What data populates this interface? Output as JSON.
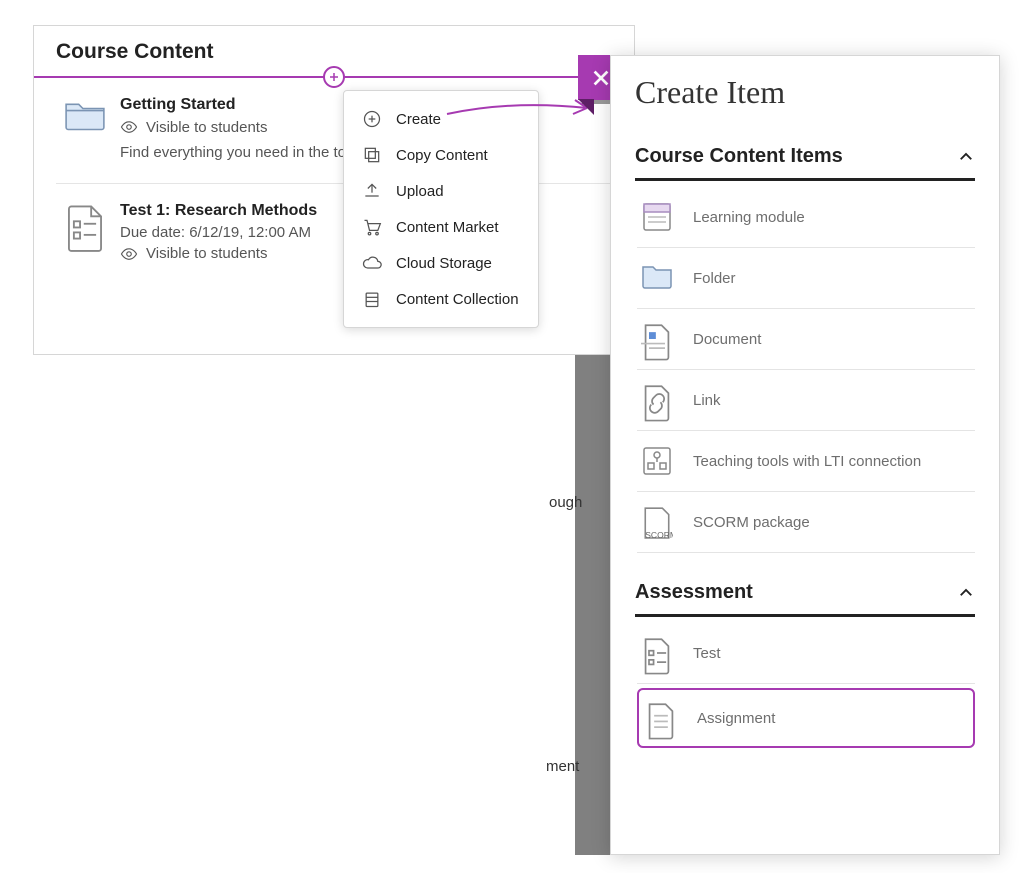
{
  "course": {
    "title": "Course Content",
    "items": [
      {
        "icon": "folder",
        "title": "Getting Started",
        "visibility": "Visible to students",
        "description": "Find everything you need in the                                       to the throughout the term."
      },
      {
        "icon": "test",
        "title": "Test 1: Research Methods",
        "subtitle": "Due date: 6/12/19, 12:00 AM",
        "visibility": "Visible to students"
      }
    ]
  },
  "context_menu": [
    {
      "icon": "plus-circle",
      "label": "Create"
    },
    {
      "icon": "copy",
      "label": "Copy Content"
    },
    {
      "icon": "upload",
      "label": "Upload"
    },
    {
      "icon": "cart",
      "label": "Content Market"
    },
    {
      "icon": "cloud",
      "label": "Cloud Storage"
    },
    {
      "icon": "collection",
      "label": "Content Collection"
    }
  ],
  "background_fragments": {
    "frag1": "ough",
    "frag2": "ment"
  },
  "create_panel": {
    "title": "Create Item",
    "sections": [
      {
        "title": "Course Content Items",
        "items": [
          {
            "icon": "module",
            "label": "Learning module"
          },
          {
            "icon": "folder",
            "label": "Folder"
          },
          {
            "icon": "document",
            "label": "Document"
          },
          {
            "icon": "link",
            "label": "Link"
          },
          {
            "icon": "lti",
            "label": "Teaching tools with LTI connection"
          },
          {
            "icon": "scorm",
            "label": "SCORM package"
          }
        ]
      },
      {
        "title": "Assessment",
        "items": [
          {
            "icon": "test",
            "label": "Test"
          },
          {
            "icon": "assignment",
            "label": "Assignment",
            "selected": true
          }
        ]
      }
    ]
  }
}
